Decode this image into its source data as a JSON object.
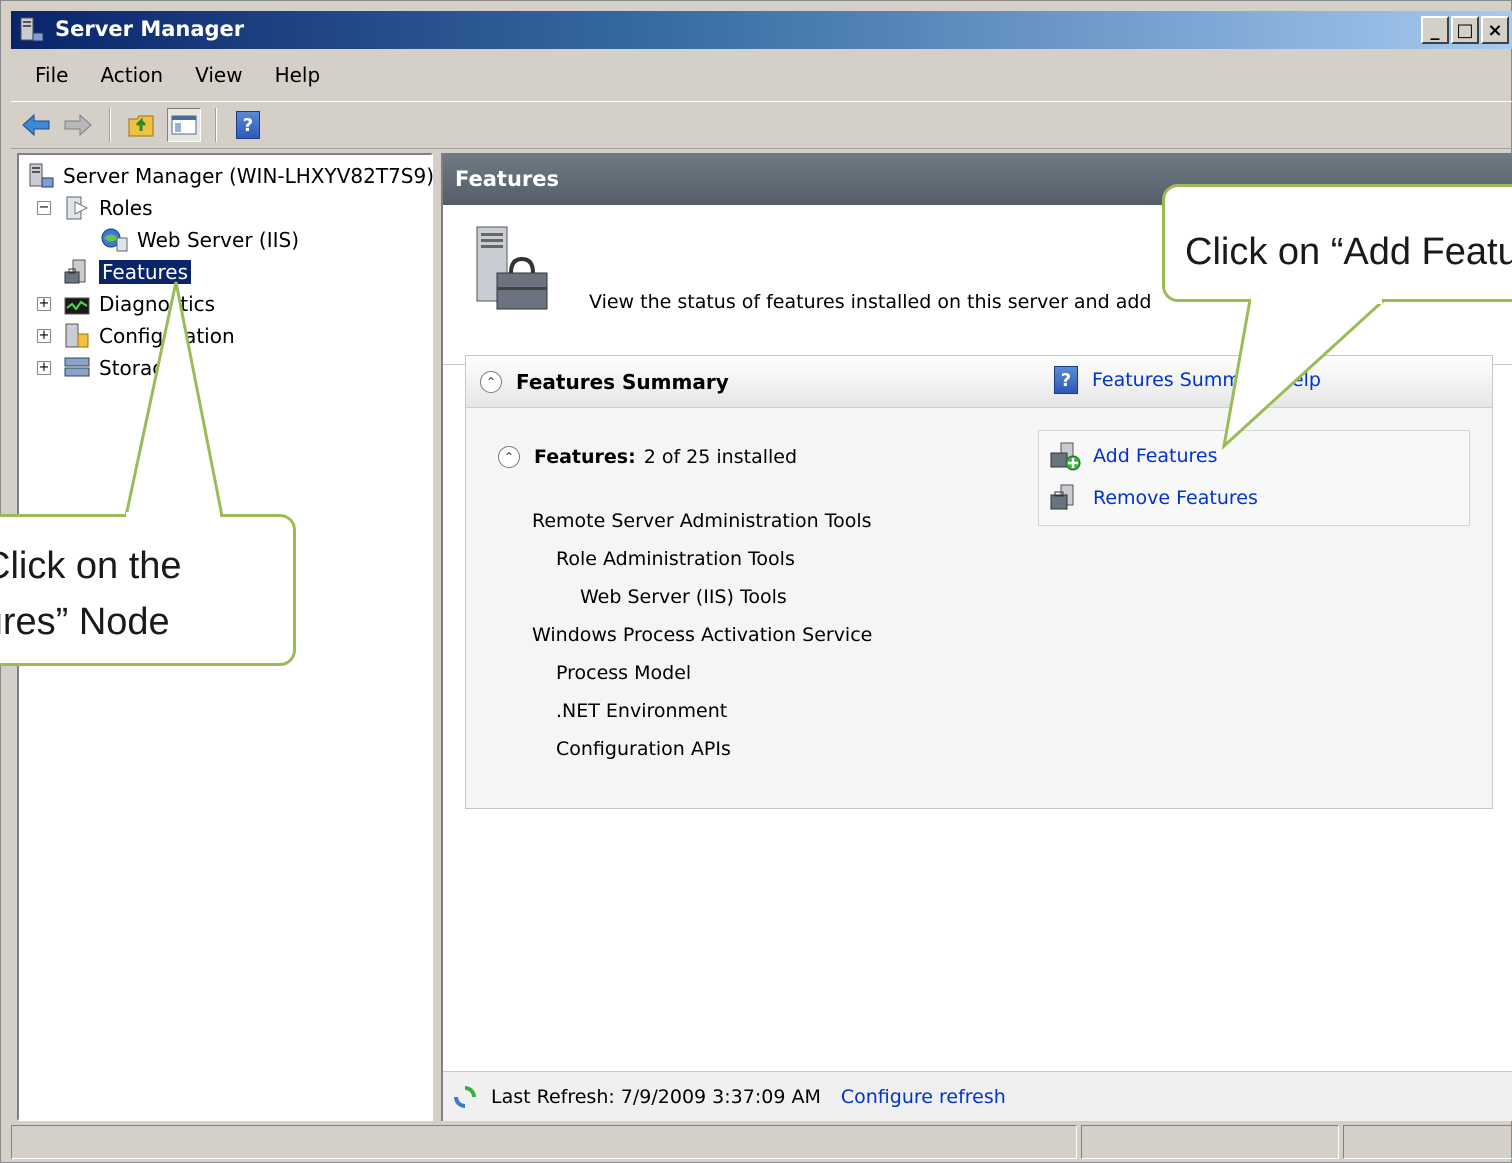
{
  "window": {
    "title": "Server Manager",
    "controls": {
      "minimize": "_",
      "maximize": "□",
      "close": "×"
    }
  },
  "menu": [
    "File",
    "Action",
    "View",
    "Help"
  ],
  "toolbar": {
    "back_icon": "back-arrow-icon",
    "forward_icon": "forward-arrow-icon",
    "up_icon": "up-folder-icon",
    "console_tree_icon": "show-hide-tree-icon",
    "help_icon": "help-icon",
    "help_label": "?"
  },
  "tree": {
    "root": "Server Manager (WIN-LHXYV82T7S9)",
    "items": [
      {
        "label": "Roles",
        "expander": "−"
      },
      {
        "label": "Web Server (IIS)"
      },
      {
        "label": "Features"
      },
      {
        "label": "Diagnostics",
        "expander": "+"
      },
      {
        "label": "Configuration",
        "expander": "+"
      },
      {
        "label": "Storage",
        "expander": "+"
      }
    ]
  },
  "main": {
    "header": "Features",
    "intro": "View the status of features installed on this server and add",
    "summary": {
      "title": "Features Summary",
      "help_link": "Features Summary Help",
      "collapse_symbol": "⌃",
      "features_label": "Features:",
      "features_count": "2 of 25 installed",
      "features": [
        "Remote Server Administration Tools",
        "Role Administration Tools",
        "Web Server (IIS) Tools",
        "Windows Process Activation Service",
        "Process Model",
        ".NET Environment",
        "Configuration APIs"
      ],
      "actions": [
        "Add Features",
        "Remove Features"
      ]
    },
    "refresh": {
      "text": "Last Refresh: 7/9/2009 3:37:09 AM",
      "link": "Configure refresh"
    }
  },
  "callouts": {
    "features_node": [
      "Click on the",
      "“Features” Node"
    ],
    "add_features": "Click on “Add Features”"
  },
  "colors": {
    "callout_border": "#9bbb59",
    "link": "#0033cc",
    "title_bar": "#0a246a"
  }
}
